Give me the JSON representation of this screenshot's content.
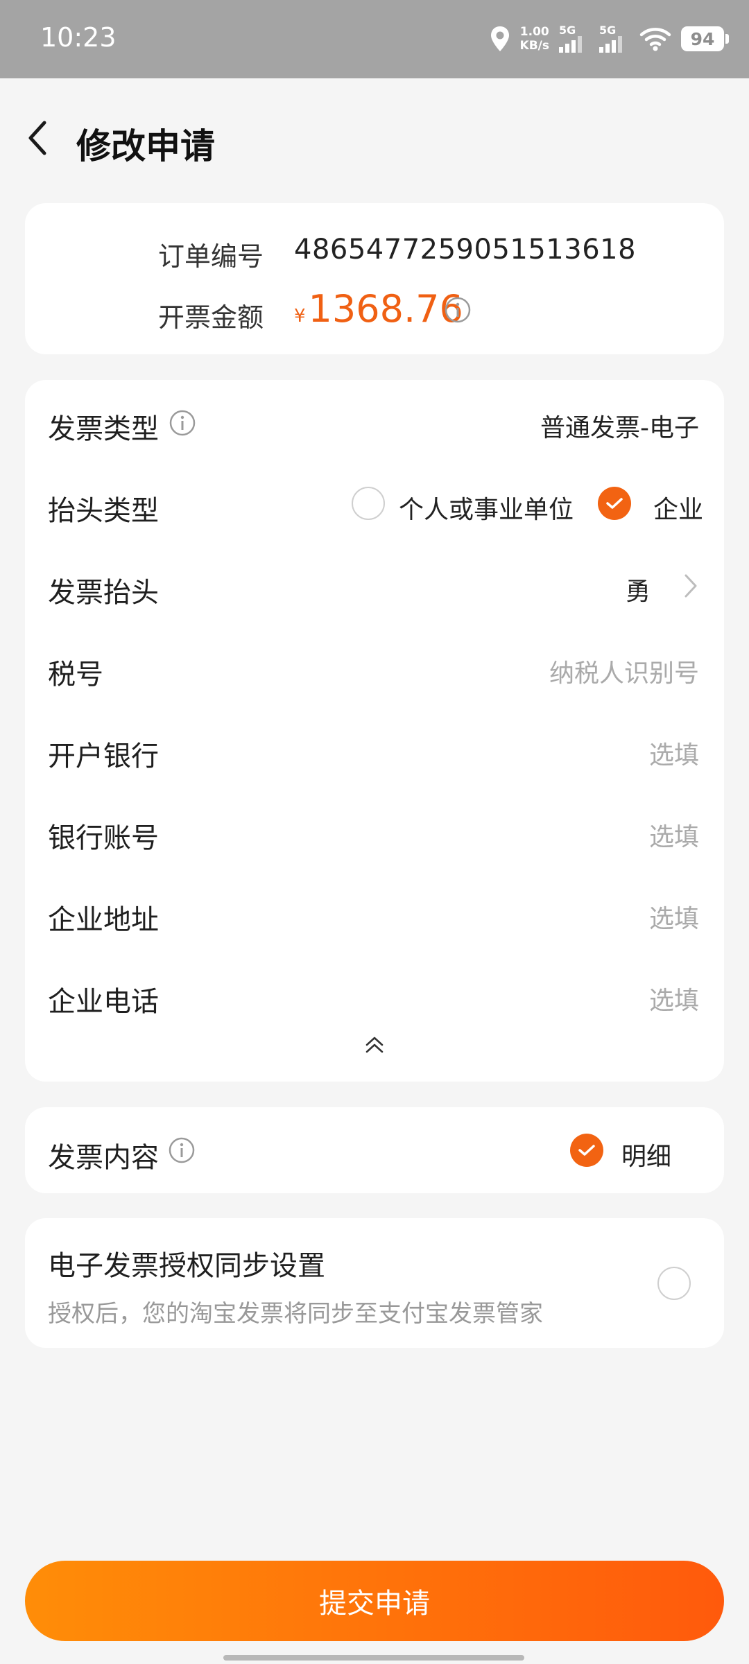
{
  "status_bar": {
    "time": "10:23",
    "net_speed_value": "1.00",
    "net_speed_unit": "KB/s",
    "sim1": "5G",
    "sim2": "5G",
    "battery": "94"
  },
  "header": {
    "title": "修改申请"
  },
  "order": {
    "order_no_label": "订单编号",
    "order_no": "4865477259051513618",
    "amount_label": "开票金额",
    "currency": "¥",
    "amount": "1368.76"
  },
  "invoice": {
    "type_label": "发票类型",
    "type_value": "普通发票-电子",
    "title_type_label": "抬头类型",
    "title_type_options": [
      {
        "label": "个人或事业单位",
        "selected": false
      },
      {
        "label": "企业",
        "selected": true
      }
    ],
    "title_label": "发票抬头",
    "title_value": "勇",
    "tax_label": "税号",
    "tax_placeholder": "纳税人识别号",
    "bank_label": "开户银行",
    "bank_placeholder": "选填",
    "account_label": "银行账号",
    "account_placeholder": "选填",
    "address_label": "企业地址",
    "address_placeholder": "选填",
    "phone_label": "企业电话",
    "phone_placeholder": "选填"
  },
  "content": {
    "label": "发票内容",
    "option": "明细",
    "selected": true
  },
  "sync": {
    "title": "电子发票授权同步设置",
    "desc": "授权后，您的淘宝发票将同步至支付宝发票管家",
    "enabled": false
  },
  "submit": {
    "label": "提交申请"
  },
  "colors": {
    "accent": "#f26312",
    "price": "#f06013",
    "button_start": "#ff8d08",
    "button_end": "#ff5a0c"
  },
  "icons": [
    "location-icon",
    "signal-icon",
    "wifi-icon",
    "battery-icon",
    "back-arrow-icon",
    "info-icon",
    "check-icon",
    "chevron-right-icon",
    "double-chevron-up-icon"
  ]
}
